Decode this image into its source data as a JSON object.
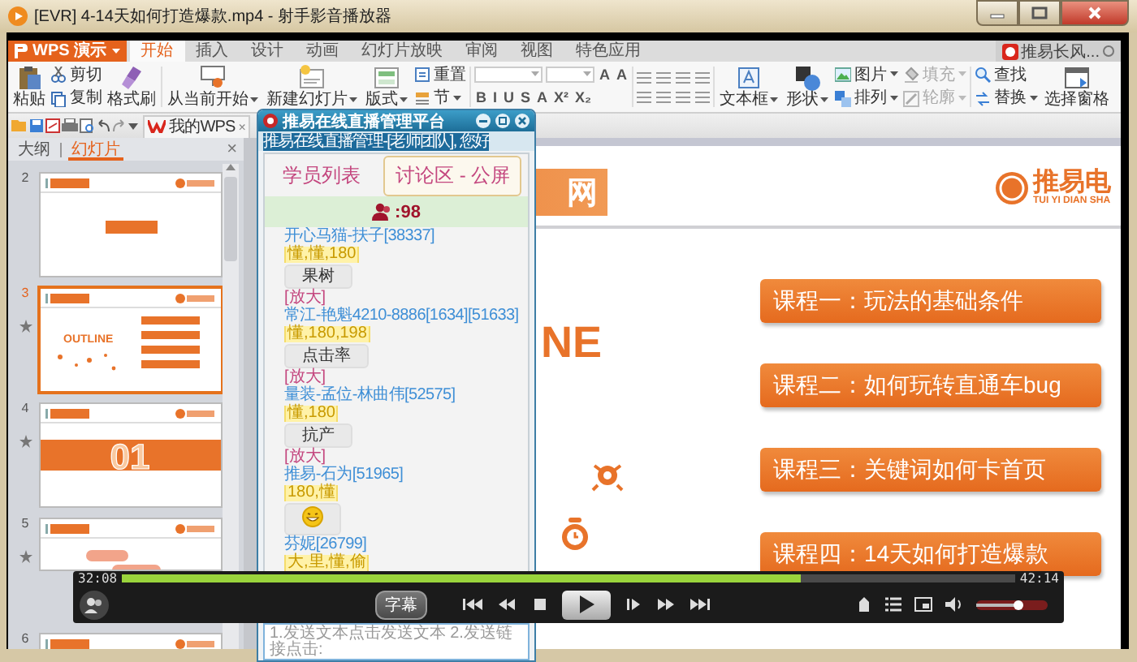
{
  "window": {
    "title": "[EVR] 4-14天如何打造爆款.mp4 - 射手影音播放器"
  },
  "wps": {
    "app_button": "WPS 演示",
    "tabs": [
      {
        "label": "开始",
        "selected": true
      },
      {
        "label": "插入",
        "selected": false
      },
      {
        "label": "设计",
        "selected": false
      },
      {
        "label": "动画",
        "selected": false
      },
      {
        "label": "幻灯片放映",
        "selected": false
      },
      {
        "label": "审阅",
        "selected": false
      },
      {
        "label": "视图",
        "selected": false
      },
      {
        "label": "特色应用",
        "selected": false
      }
    ],
    "account": "推易长风...",
    "ribbon": {
      "paste": "粘贴",
      "cut": "剪切",
      "copy": "复制",
      "format_painter": "格式刷",
      "from_current": "从当前开始",
      "new_slide": "新建幻灯片",
      "layout": "版式",
      "reset": "重置",
      "section": "节",
      "font_size_buttons": [
        "A",
        "A"
      ],
      "text_styles": [
        "B",
        "I",
        "U",
        "S",
        "A",
        "X²",
        "X₂"
      ],
      "text_box": "文本框",
      "shape": "形状",
      "picture": "图片",
      "arrange": "排列",
      "fill": {
        "label": "填充",
        "disabled": true
      },
      "outline": {
        "label": "轮廓",
        "disabled": true
      },
      "find": "查找",
      "replace": "替换",
      "selection_pane": "选择窗格"
    },
    "doc_tab": {
      "label": "我的WPS",
      "close": "×"
    }
  },
  "panel": {
    "tabs": [
      {
        "label": "大纲",
        "selected": false
      },
      {
        "label": "幻灯片",
        "selected": true
      }
    ],
    "close": "×",
    "slides": [
      {
        "number": "2",
        "kind": "button",
        "selected": false,
        "starred": false
      },
      {
        "number": "3",
        "kind": "outline",
        "text": "OUTLINE",
        "selected": true,
        "starred": true
      },
      {
        "number": "4",
        "kind": "section",
        "text": "01",
        "selected": false,
        "starred": true
      },
      {
        "number": "5",
        "kind": "bubbles",
        "selected": false,
        "starred": true
      },
      {
        "number": "6",
        "kind": "header",
        "selected": false,
        "starred": false
      }
    ]
  },
  "slide": {
    "title_end": "网",
    "logo": "推易电",
    "logo_sub": "TUI YI DIAN SHA",
    "heading_end": "NE",
    "courses": [
      "课程一：玩法的基础条件",
      "课程二：如何玩转直通车bug",
      "课程三：关键词如何卡首页",
      "课程四：14天如何打造爆款"
    ]
  },
  "chat": {
    "title": "推易在线直播管理平台",
    "greeting": "推易在线直播管理-[老师团队], 您好",
    "tabs": [
      {
        "label": "学员列表",
        "selected": false
      },
      {
        "label": "讨论区 - 公屏",
        "selected": true
      }
    ],
    "count": ":98",
    "messages": [
      {
        "name": "开心马猫-扶子[38337]",
        "tags": "懂,懂,180",
        "kind": "text",
        "content": "果树",
        "link": "[放大]"
      },
      {
        "name": "常江-艳魁4210-8886[1634][51633]",
        "tags": "懂,180,198",
        "kind": "text",
        "content": "点击率",
        "link": "[放大]"
      },
      {
        "name": "量装-孟位-林曲伟[52575]",
        "tags": "懂,180",
        "kind": "text",
        "content": "抗产",
        "link": "[放大]"
      },
      {
        "name": "推易-石为[51965]",
        "tags": "180,懂",
        "kind": "emoji"
      },
      {
        "name": "芬妮[26799]",
        "tags": "大,里,懂,偷",
        "kind": "none"
      }
    ],
    "input_placeholder": "1.发送文本点击发送文本 2.发送链接点击:"
  },
  "player": {
    "elapsed": "32:08",
    "total": "42:14",
    "level": 0.76,
    "subtitle_button": "字幕",
    "volume": {
      "level": 0.58
    }
  }
}
